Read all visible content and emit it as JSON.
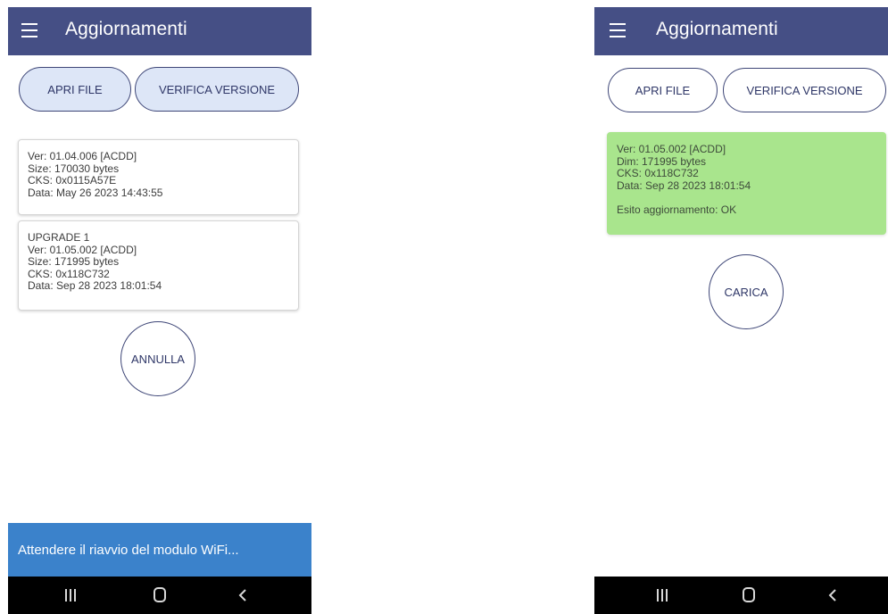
{
  "left_screen": {
    "app_bar": {
      "title": "Aggiornamenti",
      "menu_icon": "hamburger-menu-icon"
    },
    "buttons": {
      "open_file": "APRI FILE",
      "check_version": "VERIFICA VERSIONE"
    },
    "current_card": {
      "lines": [
        "Ver: 01.04.006 [ACDD]",
        "Size: 170030 bytes",
        "CKS: 0x0115A57E",
        "Data: May 26 2023 14:43:55"
      ]
    },
    "upgrade_card": {
      "lines": [
        "UPGRADE 1",
        "Ver: 01.05.002 [ACDD]",
        "Size: 171995 bytes",
        "CKS: 0x118C732",
        "Data: Sep 28 2023 18:01:54"
      ]
    },
    "cancel_button": "ANNULLA",
    "snackbar": "Attendere il riavvio del modulo WiFi..."
  },
  "right_screen": {
    "app_bar": {
      "title": "Aggiornamenti",
      "menu_icon": "hamburger-menu-icon"
    },
    "buttons": {
      "open_file": "APRI FILE",
      "check_version": "VERIFICA VERSIONE"
    },
    "result_card": {
      "lines": [
        "Ver: 01.05.002 [ACDD]",
        "Dim: 171995 bytes",
        "CKS: 0x118C732",
        "Data: Sep 28 2023 18:01:54"
      ],
      "status": "Esito aggiornamento: OK"
    },
    "load_button": "CARICA"
  },
  "nav_bar": {
    "icons": [
      "recents-icon",
      "home-icon",
      "back-icon"
    ]
  },
  "colors": {
    "app_bar": "#454f85",
    "button_border": "#3e4677",
    "active_button_fill": "#dde6f7",
    "success_card": "#a9e58d",
    "snackbar": "#3b82cb",
    "nav_bar": "#000000"
  }
}
